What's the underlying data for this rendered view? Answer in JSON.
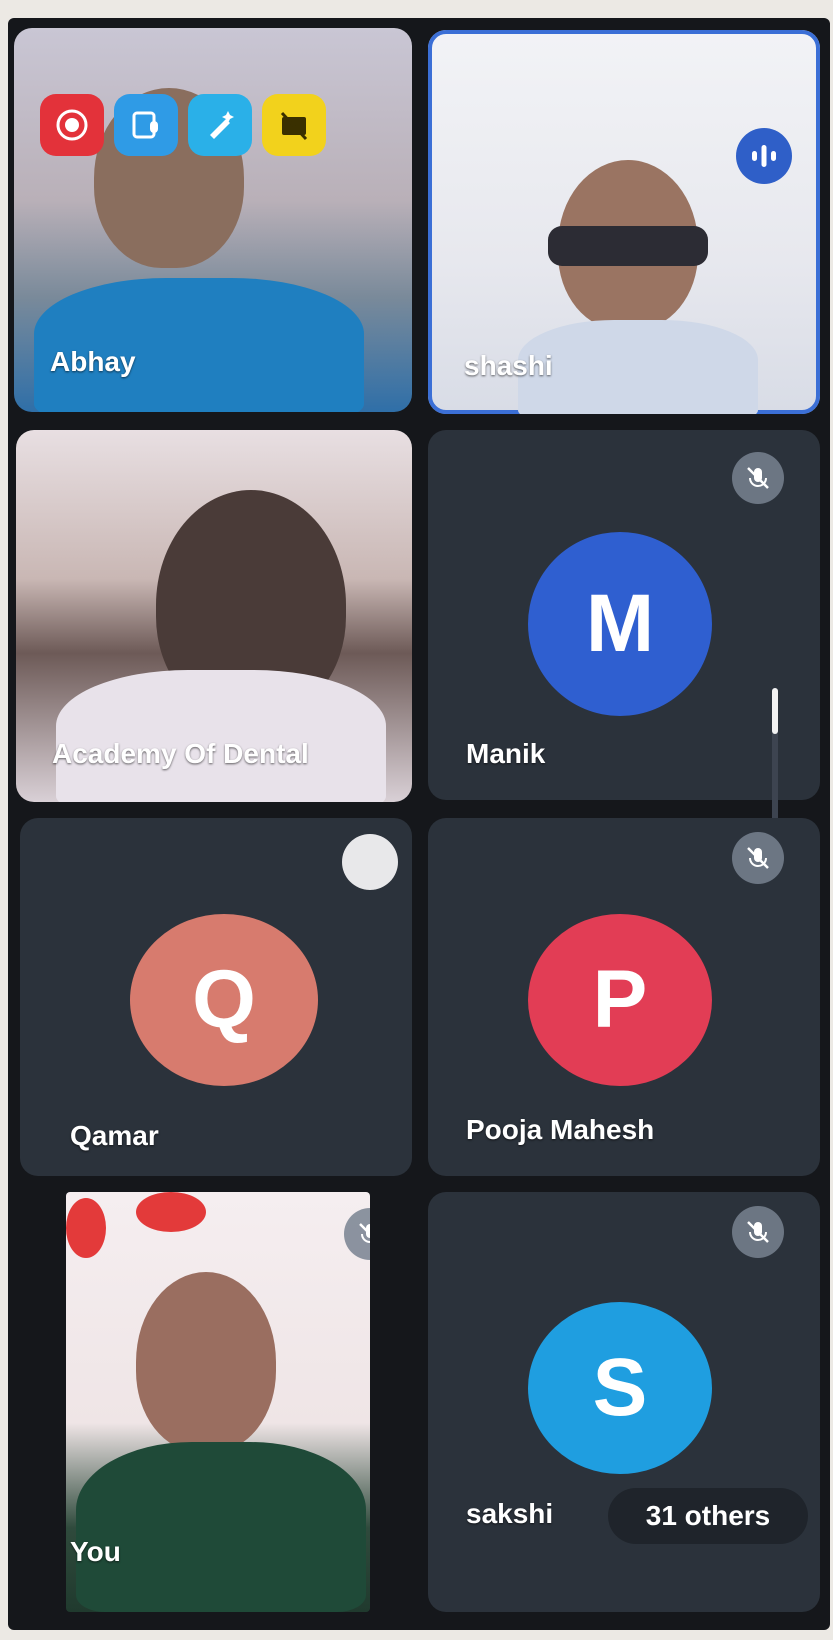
{
  "participants": {
    "abhay": {
      "name": "Abhay"
    },
    "shashi": {
      "name": "shashi"
    },
    "academy": {
      "name": "Academy Of Dental"
    },
    "manik": {
      "name": "Manik",
      "initial": "M",
      "color": "#2f5fd0"
    },
    "qamar": {
      "name": "Qamar",
      "initial": "Q",
      "color": "#d77b6e"
    },
    "pooja": {
      "name": "Pooja Mahesh",
      "initial": "P",
      "color": "#e23d55"
    },
    "you": {
      "name": "You"
    },
    "sakshi": {
      "name": "sakshi",
      "initial": "S",
      "color": "#1f9ee0"
    }
  },
  "others_label": "31 others",
  "toolbar": {
    "tools": [
      {
        "icon": "record-icon",
        "color": "#e3323a"
      },
      {
        "icon": "transcript-icon",
        "color": "#2f9be6"
      },
      {
        "icon": "pen-sparkle-icon",
        "color": "#2ab0e8"
      },
      {
        "icon": "camera-off-icon",
        "color": "#f2d21c"
      }
    ]
  },
  "colors": {
    "accent": "#3b6fd6",
    "tile_bg": "#2b323b",
    "screen_bg": "#15171b"
  }
}
